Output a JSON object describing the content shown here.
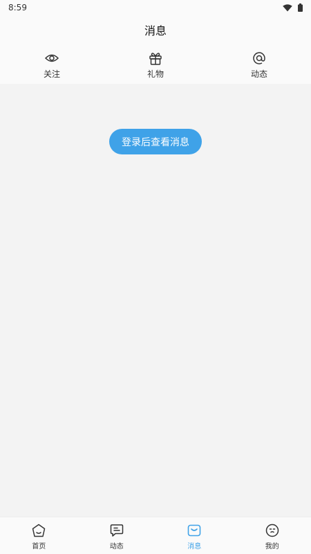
{
  "status_bar": {
    "time": "8:59",
    "icons": [
      "wifi-icon",
      "battery-icon"
    ]
  },
  "header": {
    "title": "消息"
  },
  "quick_nav": [
    {
      "label": "关注",
      "icon": "eye-icon"
    },
    {
      "label": "礼物",
      "icon": "gift-icon"
    },
    {
      "label": "动态",
      "icon": "at-icon"
    }
  ],
  "main": {
    "login_button": "登录后查看消息"
  },
  "tab_bar": [
    {
      "label": "首页",
      "icon": "home-icon",
      "active": false
    },
    {
      "label": "动态",
      "icon": "chat-icon",
      "active": false
    },
    {
      "label": "消息",
      "icon": "message-icon",
      "active": true
    },
    {
      "label": "我的",
      "icon": "profile-icon",
      "active": false
    }
  ],
  "colors": {
    "accent": "#3fa2e8",
    "background": "#f3f3f3",
    "bar": "#fafafa"
  }
}
